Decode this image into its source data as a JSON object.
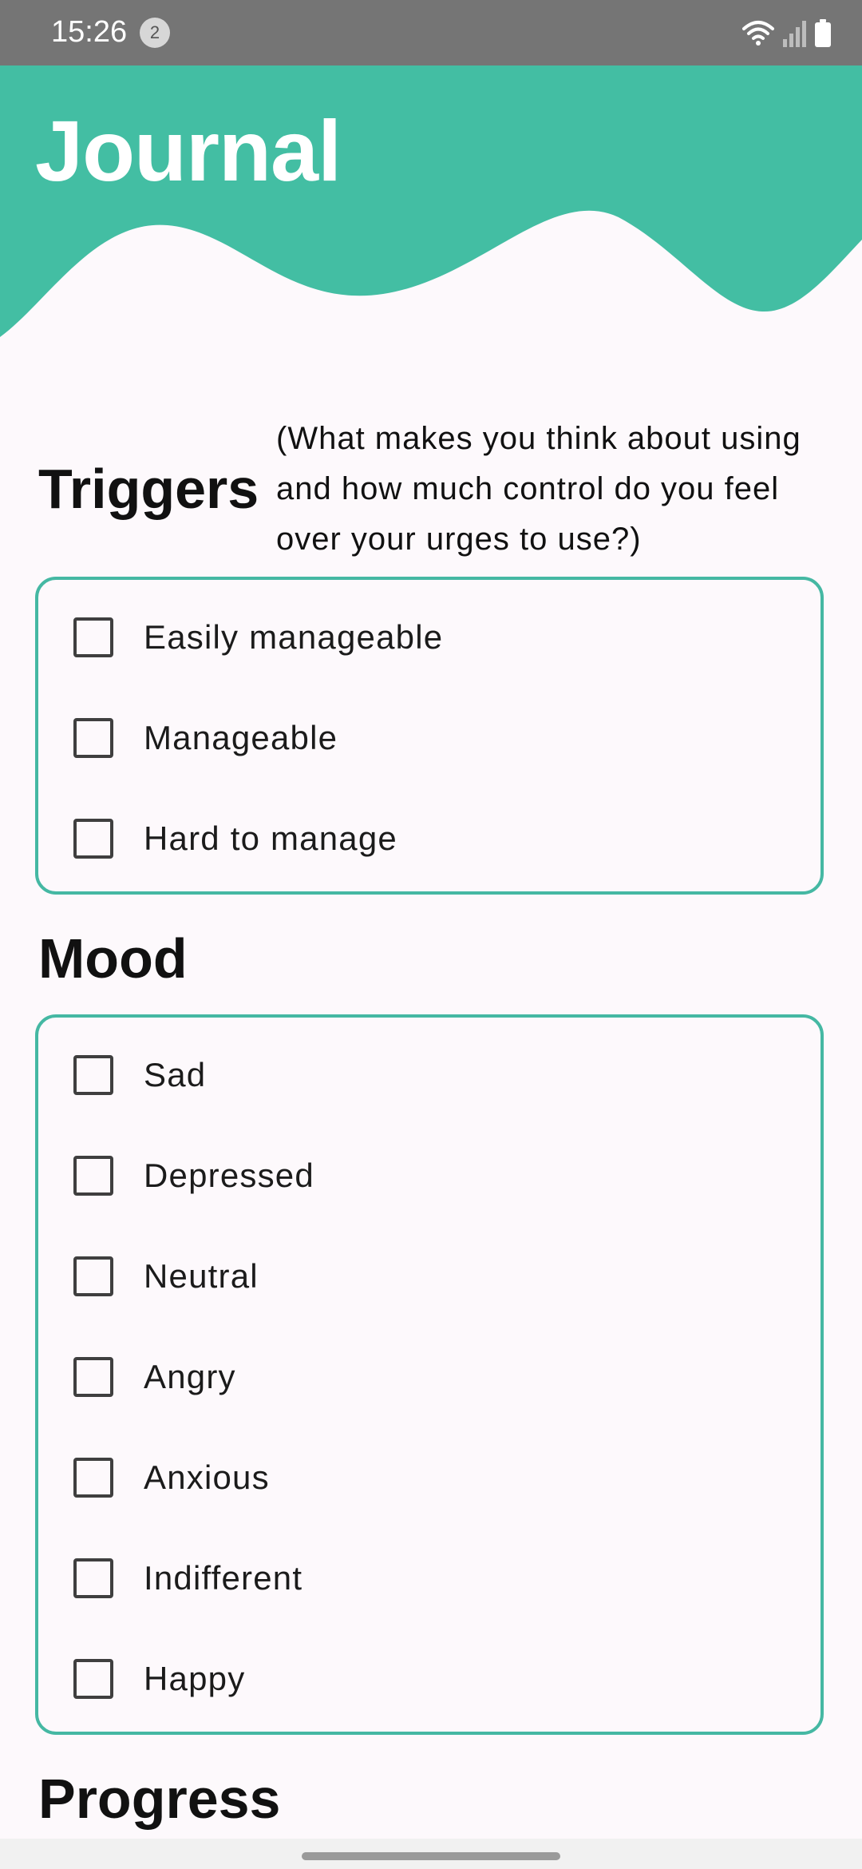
{
  "status_bar": {
    "time": "15:26",
    "notification_count": "2",
    "icons": [
      "wifi-icon",
      "signal-icon",
      "battery-icon"
    ]
  },
  "header": {
    "title": "Journal",
    "accent_color": "#43bea3"
  },
  "triggers": {
    "heading": "Triggers",
    "note_line1": "(What makes you think about using",
    "note_line2": "and how much control do you feel",
    "note_line3": "over your urges to use?)",
    "options": [
      {
        "label": "Easily manageable",
        "checked": false
      },
      {
        "label": "Manageable",
        "checked": false
      },
      {
        "label": "Hard to manage",
        "checked": false
      }
    ]
  },
  "mood": {
    "heading": "Mood",
    "options": [
      {
        "label": "Sad",
        "checked": false
      },
      {
        "label": "Depressed",
        "checked": false
      },
      {
        "label": "Neutral",
        "checked": false
      },
      {
        "label": "Angry",
        "checked": false
      },
      {
        "label": "Anxious",
        "checked": false
      },
      {
        "label": "Indifferent",
        "checked": false
      },
      {
        "label": "Happy",
        "checked": false
      }
    ]
  },
  "progress": {
    "heading": "Progress"
  },
  "colors": {
    "card_border": "#45b8a3",
    "background": "#fdf9fc",
    "status_bar": "#757575"
  }
}
